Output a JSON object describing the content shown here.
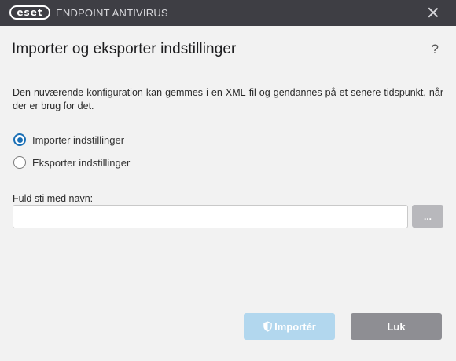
{
  "window": {
    "brand": "eset",
    "product_name": "ENDPOINT ANTIVIRUS",
    "colors": {
      "titlebar": "#3e3e44",
      "accent": "#1a6fb5",
      "import_button": "#b2d7ee",
      "close_button": "#8e8e93"
    }
  },
  "dialog": {
    "title": "Importer og eksporter indstillinger",
    "help": "?",
    "description": "Den nuværende konfiguration kan gemmes i en XML-fil og gendannes på et senere tidspunkt, når der er brug for det.",
    "options": [
      {
        "label": "Importer indstillinger",
        "checked": true
      },
      {
        "label": "Eksporter indstillinger",
        "checked": false
      }
    ],
    "path_label": "Fuld sti med navn:",
    "path_value": "",
    "browse_label": "...",
    "import_label": "Importér",
    "import_icon": "shield-icon",
    "close_label": "Luk"
  }
}
